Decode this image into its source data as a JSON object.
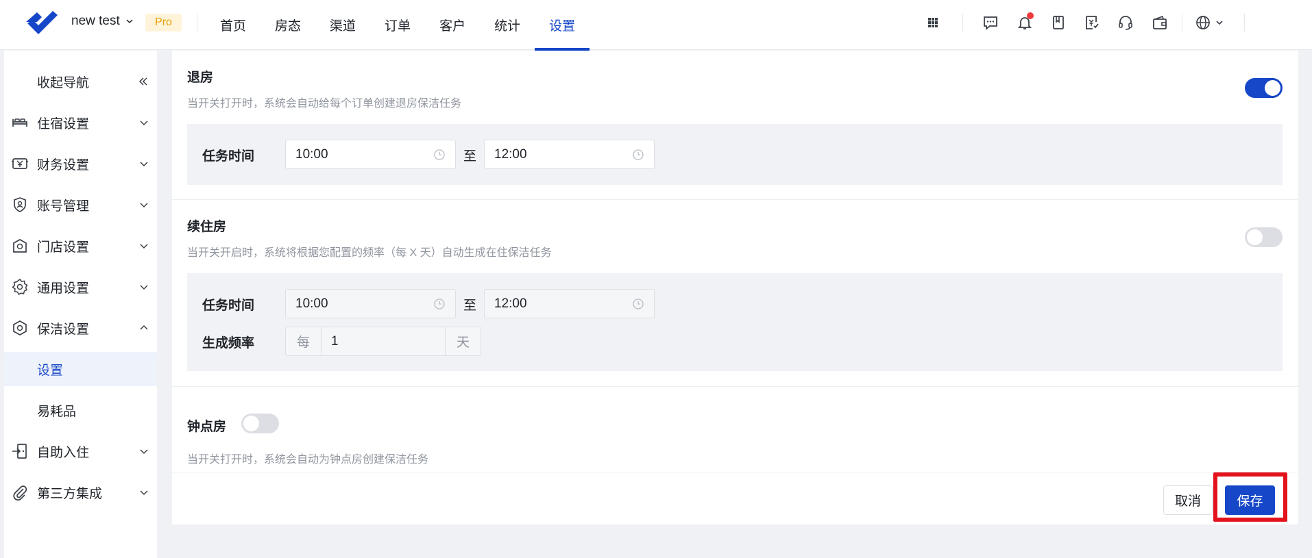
{
  "header": {
    "account_name": "new test",
    "badge": "Pro",
    "nav": [
      "首页",
      "房态",
      "渠道",
      "订单",
      "客户",
      "统计",
      "设置"
    ],
    "active_nav_index": 6
  },
  "sidebar": {
    "collapse_label": "收起导航",
    "items": [
      {
        "label": "住宿设置",
        "icon": "bed-icon"
      },
      {
        "label": "财务设置",
        "icon": "cash-register-icon"
      },
      {
        "label": "账号管理",
        "icon": "user-shield-icon"
      },
      {
        "label": "门店设置",
        "icon": "store-icon"
      },
      {
        "label": "通用设置",
        "icon": "gear-icon"
      },
      {
        "label": "保洁设置",
        "icon": "hexagon-icon"
      },
      {
        "label": "设置"
      },
      {
        "label": "易耗品"
      },
      {
        "label": "自助入住",
        "icon": "door-icon"
      },
      {
        "label": "第三方集成",
        "icon": "paperclip-icon"
      }
    ]
  },
  "checkout": {
    "title": "退房",
    "desc": "当开关打开时，系统会自动给每个订单创建退房保洁任务",
    "enabled": true,
    "task_time_label": "任务时间",
    "start_time": "10:00",
    "to": "至",
    "end_time": "12:00"
  },
  "stayover": {
    "title": "续住房",
    "desc": "当开关开启时，系统将根据您配置的频率（每 X 天）自动生成在住保洁任务",
    "enabled": false,
    "task_time_label": "任务时间",
    "start_time": "10:00",
    "to": "至",
    "end_time": "12:00",
    "freq_label": "生成频率",
    "freq_prefix": "每",
    "freq_value": "1",
    "freq_suffix": "天"
  },
  "hourly": {
    "title": "钟点房",
    "desc": "当开关打开时，系统会自动为钟点房创建保洁任务",
    "enabled": false
  },
  "footer": {
    "cancel": "取消",
    "save": "保存"
  },
  "colors": {
    "primary": "#1647c8",
    "highlight": "#e3121c",
    "badge_bg": "#fff4da",
    "badge_text": "#e6a100"
  }
}
